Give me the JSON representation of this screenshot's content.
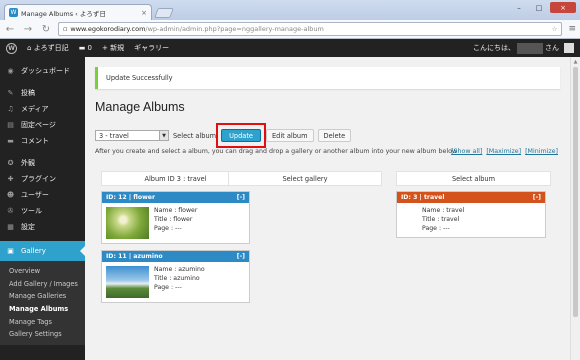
{
  "browser": {
    "tab_title": "Manage Albums ‹ よろず日",
    "tab_close": "×",
    "url_domain": "www.egokorodiary.com",
    "url_path": "/wp-admin/admin.php?page=nggallery-manage-album",
    "controls": [
      "–",
      "□",
      "×"
    ]
  },
  "adminbar": {
    "site": "よろず日記",
    "comments_count": "0",
    "new_label": "新規",
    "gallery_label": "ギャラリー",
    "greeting": "こんにちは、",
    "greeting_suffix": "さん"
  },
  "sidebar": {
    "items": [
      {
        "label": "ダッシュボード",
        "icon": "dashboard-icon",
        "glyph": "◉"
      },
      {
        "label": "投稿",
        "icon": "pin-icon",
        "glyph": "✎"
      },
      {
        "label": "メディア",
        "icon": "media-icon",
        "glyph": "♫"
      },
      {
        "label": "固定ページ",
        "icon": "page-icon",
        "glyph": "▤"
      },
      {
        "label": "コメント",
        "icon": "comment-icon",
        "glyph": "▬"
      },
      {
        "label": "外観",
        "icon": "appearance-icon",
        "glyph": "✪"
      },
      {
        "label": "プラグイン",
        "icon": "plugin-icon",
        "glyph": "✚"
      },
      {
        "label": "ユーザー",
        "icon": "user-icon",
        "glyph": "☻"
      },
      {
        "label": "ツール",
        "icon": "tool-icon",
        "glyph": "✇"
      },
      {
        "label": "設定",
        "icon": "settings-icon",
        "glyph": "▦"
      }
    ],
    "active": {
      "label": "Gallery",
      "icon": "gallery-icon",
      "glyph": "▣"
    },
    "submenu": [
      "Overview",
      "Add Gallery / Images",
      "Manage Galleries",
      "Manage Albums",
      "Manage Tags",
      "Gallery Settings"
    ]
  },
  "main": {
    "notice": "Update Successfully",
    "title": "Manage Albums",
    "select_value": "3 - travel",
    "select_label": "Select album",
    "update_button": "Update",
    "edit_button": "Edit album",
    "delete_button": "Delete",
    "instructions": "After you create and select a album, you can drag and drop a gallery or another album into your new album below",
    "links": [
      "[Show all]",
      "[Maximize]",
      "[Minimize]"
    ],
    "col_left": "Album ID 3 : travel",
    "col_mid": "Select gallery",
    "col_right": "Select album"
  },
  "cards": [
    {
      "header": "ID: 12 | flower",
      "toggle": "[-]",
      "name": "Name : flower",
      "title": "Title : flower",
      "page": "Page : ---"
    },
    {
      "header": "ID: 11 | azumino",
      "toggle": "[-]",
      "name": "Name : azumino",
      "title": "Title : azumino",
      "page": "Page : ---"
    },
    {
      "header": "ID: 3 | travel",
      "toggle": "[-]",
      "name": "Name : travel",
      "title": "Title : travel",
      "page": "Page : ---"
    }
  ],
  "colors": {
    "accent": "#2ea2cc",
    "card_blue": "#2e8ac4",
    "card_orange": "#d4521c",
    "highlight": "#e01010"
  }
}
